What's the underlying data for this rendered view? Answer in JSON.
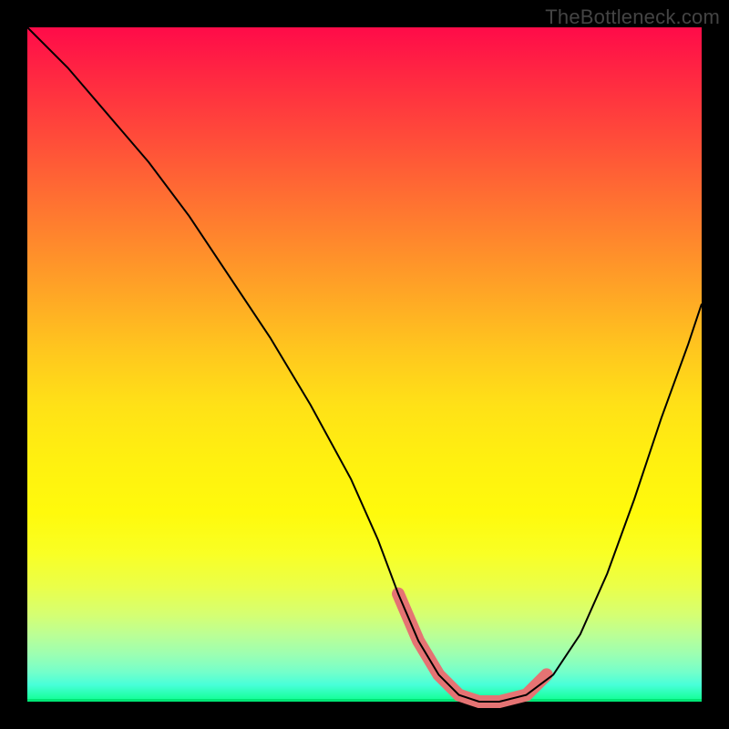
{
  "watermark": "TheBottleneck.com",
  "colors": {
    "background": "#000000",
    "curve": "#000000",
    "highlight": "#e57373"
  },
  "chart_data": {
    "type": "line",
    "title": "",
    "xlabel": "",
    "ylabel": "",
    "xlim": [
      0,
      100
    ],
    "ylim": [
      0,
      100
    ],
    "grid": false,
    "legend": false,
    "series": [
      {
        "name": "bottleneck-curve",
        "x": [
          0,
          6,
          12,
          18,
          24,
          30,
          36,
          42,
          48,
          52,
          55,
          58,
          61,
          64,
          67,
          70,
          74,
          78,
          82,
          86,
          90,
          94,
          98,
          100
        ],
        "y": [
          100,
          94,
          87,
          80,
          72,
          63,
          54,
          44,
          33,
          24,
          16,
          9,
          4,
          1,
          0,
          0,
          1,
          4,
          10,
          19,
          30,
          42,
          53,
          59
        ]
      },
      {
        "name": "highlight-segment",
        "x": [
          55,
          58,
          61,
          64,
          67,
          70,
          74,
          77
        ],
        "y": [
          16,
          9,
          4,
          1,
          0,
          0,
          1,
          4
        ]
      }
    ],
    "annotations": []
  }
}
